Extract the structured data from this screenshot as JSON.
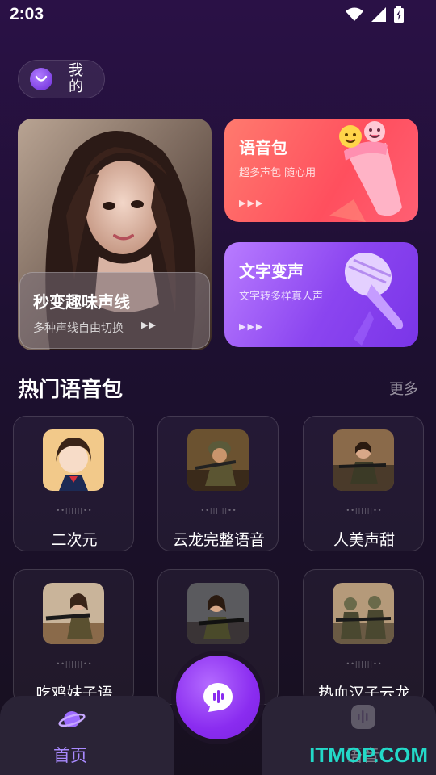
{
  "status_bar": {
    "time": "2:03"
  },
  "header": {
    "mine_label": "我的"
  },
  "feature_card": {
    "title": "秒变趣味声线",
    "subtitle": "多种声线自由切换",
    "arrows": "▶▶"
  },
  "voice_pack_card": {
    "title": "语音包",
    "subtitle": "超多声包 随心用",
    "arrows": "▶▶▶"
  },
  "text_voice_card": {
    "title": "文字变声",
    "subtitle": "文字转多样真人声",
    "arrows": "▶▶▶"
  },
  "hot_section": {
    "title": "热门语音包",
    "more": "更多",
    "items": [
      {
        "name": "二次元",
        "wave": "••||||||••",
        "thumb": "anime-girl"
      },
      {
        "name": "云龙完整语音",
        "wave": "••||||||••",
        "thumb": "soldier"
      },
      {
        "name": "人美声甜",
        "wave": "••||||||••",
        "thumb": "woman-soldier"
      },
      {
        "name": "吃鸡妹子语",
        "wave": "••||||||••",
        "thumb": "woman-rifle"
      },
      {
        "name": "",
        "wave": "••||||||••",
        "thumb": "woman-rifle-2"
      },
      {
        "name": "热血汉子云龙",
        "wave": "••||||||••",
        "thumb": "squad"
      }
    ]
  },
  "bottom_nav": {
    "home_label": "首页",
    "voice_label": "语音"
  },
  "watermark": "ITMOP.COM",
  "colors": {
    "accent": "#a98aff",
    "voice_pack": "#ff5f6b",
    "text_voice": "#8b45f0",
    "center_button": "#8a2cf0",
    "watermark": "#23d9c8"
  }
}
